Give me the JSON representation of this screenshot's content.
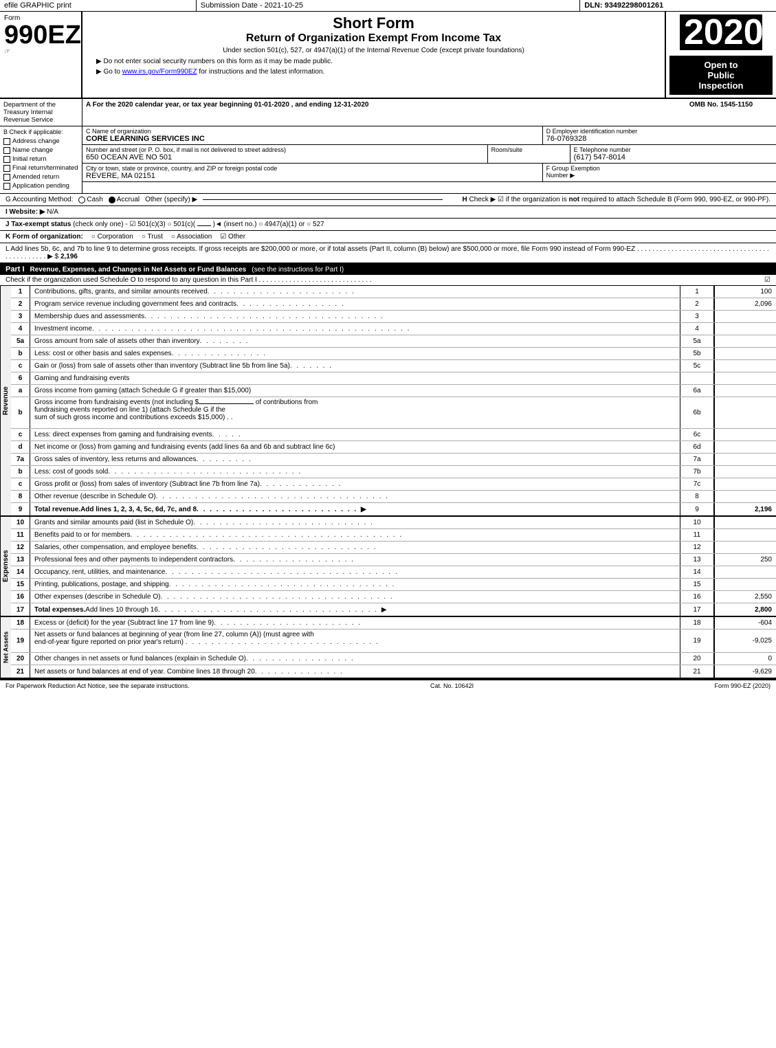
{
  "topbar": {
    "left": "efile GRAPHIC print",
    "middle": "Submission Date - 2021-10-25",
    "right": "DLN: 93492298001261"
  },
  "header": {
    "form_label": "Form",
    "form_number": "990EZ",
    "form_icon": "☞",
    "short_form": "Short Form",
    "return_title": "Return of Organization Exempt From Income Tax",
    "under_section": "Under section 501(c), 527, or 4947(a)(1) of the Internal Revenue Code (except private foundations)",
    "do_not_enter": "▶ Do not enter social security numbers on this form as it may be made public.",
    "go_to": "▶ Go to www.irs.gov/Form990EZ for instructions and the latest information.",
    "irs_url": "www.irs.gov/Form990EZ",
    "year": "2020",
    "omb": "OMB No. 1545-1150",
    "open_to_public": "Open to",
    "public_line": "Public",
    "inspection_line": "Inspection"
  },
  "section_a": {
    "dept": "Department of the Treasury Internal Revenue Service",
    "tax_year": "A For the 2020 calendar year, or tax year beginning 01-01-2020 , and ending 12-31-2020"
  },
  "checks": {
    "header": "B Check if applicable:",
    "items": [
      {
        "label": "Address change",
        "checked": false
      },
      {
        "label": "Name change",
        "checked": false
      },
      {
        "label": "Initial return",
        "checked": false
      },
      {
        "label": "Final return/terminated",
        "checked": false
      },
      {
        "label": "Amended return",
        "checked": false
      },
      {
        "label": "Application pending",
        "checked": false
      }
    ]
  },
  "org": {
    "c_label": "C Name of organization",
    "c_value": "CORE LEARNING SERVICES INC",
    "d_label": "D Employer identification number",
    "d_value": "76-0769328",
    "address_label": "Number and street (or P. O. box, if mail is not delivered to street address)",
    "address_value": "650 OCEAN AVE NO 501",
    "room_label": "Room/suite",
    "room_value": "",
    "e_label": "E Telephone number",
    "e_value": "(617) 547-8014",
    "city_label": "City or town, state or province, country, and ZIP or foreign postal code",
    "city_value": "REVERE, MA  02151",
    "f_label": "F Group Exemption Number",
    "f_arrow": "▶"
  },
  "accounting": {
    "g_label": "G Accounting Method:",
    "cash": "Cash",
    "accrual": "Accrual",
    "other": "Other (specify) ▶",
    "accrual_checked": true,
    "cash_checked": false
  },
  "website": {
    "i_label": "I Website: ▶",
    "i_value": "N/A"
  },
  "tax_exempt": {
    "j_label": "J Tax-exempt status",
    "j_note": "(check only one)",
    "c501c3": "☑ 501(c)(3)",
    "c501c": "○ 501(c)(",
    "insert": ")◄ (insert no.)",
    "c4947": "○ 4947(a)(1) or",
    "c527": "○ 527"
  },
  "k_form": {
    "k_label": "K Form of organization:",
    "corporation": "○ Corporation",
    "trust": "○ Trust",
    "association": "○ Association",
    "other": "☑ Other"
  },
  "l_add": {
    "text": "L Add lines 5b, 6c, and 7b to line 9 to determine gross receipts. If gross receipts are $200,000 or more, or if total assets (Part II, column (B) below) are $500,000 or more, file Form 990 instead of Form 990-EZ . . . . . . . . . . . . . . . . . . . . . . . . . . . . . . . . . . . . . . . . . . . . . . ▶ $",
    "value": "2,196"
  },
  "part1": {
    "label": "Part I",
    "title": "Revenue, Expenses, and Changes in Net Assets or Fund Balances",
    "see_instructions": "(see the instructions for Part I)",
    "check_schedule": "Check if the organization used Schedule O to respond to any question in this Part I . . . . . . . . . . . . . . . . . . . . . . . . . . . . . .",
    "check_value": "☑",
    "lines": [
      {
        "num": "1",
        "desc": "Contributions, gifts, grants, and similar amounts received . . . . . . . . . . . . . . . . . . . . . . .",
        "ref": "1",
        "value": "100"
      },
      {
        "num": "2",
        "desc": "Program service revenue including government fees and contracts . . . . . . . . . . . . . . . . .",
        "ref": "2",
        "value": "2,096"
      },
      {
        "num": "3",
        "desc": "Membership dues and assessments . . . . . . . . . . . . . . . . . . . . . . . . . . . . . . . . . . . . .",
        "ref": "3",
        "value": ""
      },
      {
        "num": "4",
        "desc": "Investment income . . . . . . . . . . . . . . . . . . . . . . . . . . . . . . . . . . . . . . . . . . . . . . . . .",
        "ref": "4",
        "value": ""
      },
      {
        "num": "5a",
        "desc": "Gross amount from sale of assets other than inventory . . . . . . . .",
        "ref": "5a",
        "value": ""
      },
      {
        "num": "b",
        "desc": "Less: cost or other basis and sales expenses . . . . . . . . . . . . . . .",
        "ref": "5b",
        "value": ""
      },
      {
        "num": "c",
        "desc": "Gain or (loss) from sale of assets other than inventory (Subtract line 5b from line 5a) . . . . . . .",
        "ref": "5c",
        "value": ""
      },
      {
        "num": "6",
        "desc": "Gaming and fundraising events",
        "ref": "",
        "value": ""
      },
      {
        "num": "a",
        "desc": "Gross income from gaming (attach Schedule G if greater than $15,000)",
        "ref": "6a",
        "value": ""
      },
      {
        "num": "b",
        "desc": "Gross income from fundraising events (not including $_______________  of contributions from fundraising events reported on line 1) (attach Schedule G if the sum of such gross income and contributions exceeds $15,000) . .",
        "ref": "6b",
        "value": ""
      },
      {
        "num": "c",
        "desc": "Less: direct expenses from gaming and fundraising events . . . . .",
        "ref": "6c",
        "value": ""
      },
      {
        "num": "d",
        "desc": "Net income or (loss) from gaming and fundraising events (add lines 6a and 6b and subtract line 6c)",
        "ref": "6d",
        "value": ""
      },
      {
        "num": "7a",
        "desc": "Gross sales of inventory, less returns and allowances . . . . . . . . .",
        "ref": "7a",
        "value": ""
      },
      {
        "num": "b",
        "desc": "Less: cost of goods sold . . . . . . . . . . . . . . . . . . . . . . . . . . . . . .",
        "ref": "7b",
        "value": ""
      },
      {
        "num": "c",
        "desc": "Gross profit or (loss) from sales of inventory (Subtract line 7b from line 7a) . . . . . . . . . . . . .",
        "ref": "7c",
        "value": ""
      },
      {
        "num": "8",
        "desc": "Other revenue (describe in Schedule O) . . . . . . . . . . . . . . . . . . . . . . . . . . . . . . . . . . . .",
        "ref": "8",
        "value": ""
      },
      {
        "num": "9",
        "desc": "Total revenue. Add lines 1, 2, 3, 4, 5c, 6d, 7c, and 8 . . . . . . . . . . . . . . . . . . . . . . . . . ▶",
        "ref": "9",
        "value": "2,196",
        "bold": true
      }
    ]
  },
  "expenses": {
    "lines": [
      {
        "num": "10",
        "desc": "Grants and similar amounts paid (list in Schedule O) . . . . . . . . . . . . . . . . . . . . . . . . . . . .",
        "ref": "10",
        "value": ""
      },
      {
        "num": "11",
        "desc": "Benefits paid to or for members . . . . . . . . . . . . . . . . . . . . . . . . . . . . . . . . . . . . . . . . . .",
        "ref": "11",
        "value": ""
      },
      {
        "num": "12",
        "desc": "Salaries, other compensation, and employee benefits . . . . . . . . . . . . . . . . . . . . . . . . . . . .",
        "ref": "12",
        "value": ""
      },
      {
        "num": "13",
        "desc": "Professional fees and other payments to independent contractors . . . . . . . . . . . . . . . . . . . .",
        "ref": "13",
        "value": "250"
      },
      {
        "num": "14",
        "desc": "Occupancy, rent, utilities, and maintenance . . . . . . . . . . . . . . . . . . . . . . . . . . . . . . . . . . .",
        "ref": "14",
        "value": ""
      },
      {
        "num": "15",
        "desc": "Printing, publications, postage, and shipping . . . . . . . . . . . . . . . . . . . . . . . . . . . . . . . . . .",
        "ref": "15",
        "value": ""
      },
      {
        "num": "16",
        "desc": "Other expenses (describe in Schedule O) . . . . . . . . . . . . . . . . . . . . . . . . . . . . . . . . . . . .",
        "ref": "16",
        "value": "2,550"
      },
      {
        "num": "17",
        "desc": "Total expenses. Add lines 10 through 16 . . . . . . . . . . . . . . . . . . . . . . . . . . . . . . . . . ▶",
        "ref": "17",
        "value": "2,800",
        "bold": true
      }
    ]
  },
  "net_assets_part1": {
    "lines": [
      {
        "num": "18",
        "desc": "Excess or (deficit) for the year (Subtract line 17 from line 9) . . . . . . . . . . . . . . . . . . . . . . .",
        "ref": "18",
        "value": "-604"
      },
      {
        "num": "19",
        "desc": "Net assets or fund balances at beginning of year (from line 27, column (A)) (must agree with end-of-year figure reported on prior year's return) . . . . . . . . . . . . . . . . . . . . . . . . . . . . . .",
        "ref": "19",
        "value": "-9,025"
      },
      {
        "num": "20",
        "desc": "Other changes in net assets or fund balances (explain in Schedule O) . . . . . . . . . . . . . . . . .",
        "ref": "20",
        "value": "0"
      },
      {
        "num": "21",
        "desc": "Net assets or fund balances at end of year. Combine lines 18 through 20 . . . . . . . . . . . . . .",
        "ref": "21",
        "value": "-9,629"
      }
    ]
  },
  "footer": {
    "left": "For Paperwork Reduction Act Notice, see the separate instructions.",
    "middle": "Cat. No. 10642I",
    "right": "Form 990-EZ (2020)"
  }
}
